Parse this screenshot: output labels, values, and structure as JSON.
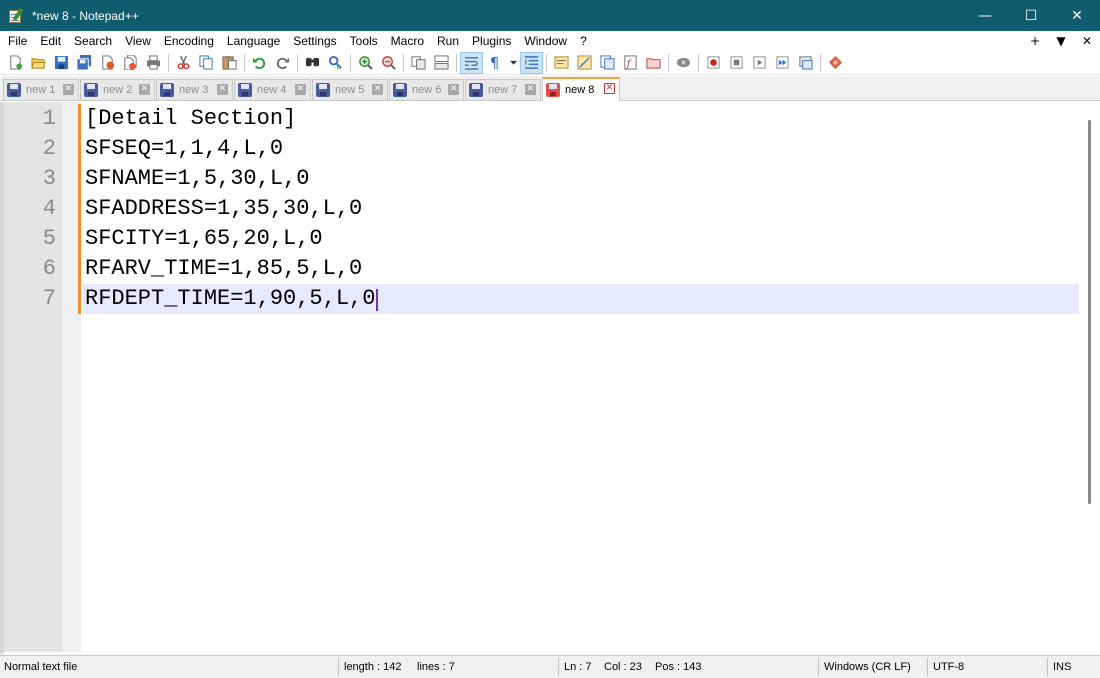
{
  "window": {
    "title": "*new 8 - Notepad++",
    "controls": {
      "minimize": "—",
      "maximize": "☐",
      "close": "✕"
    }
  },
  "menu": {
    "items": [
      "File",
      "Edit",
      "Search",
      "View",
      "Encoding",
      "Language",
      "Settings",
      "Tools",
      "Macro",
      "Run",
      "Plugins",
      "Window",
      "?"
    ],
    "right": [
      "+",
      "▼",
      "✕"
    ]
  },
  "toolbar": {
    "icons": [
      "new-file-icon",
      "open-file-icon",
      "save-icon",
      "save-all-icon",
      "close-icon",
      "close-all-icon",
      "print-icon",
      "cut-icon",
      "copy-icon",
      "paste-icon",
      "undo-icon",
      "redo-icon",
      "find-icon",
      "replace-icon",
      "zoom-in-icon",
      "zoom-out-icon",
      "sync-vertical-icon",
      "sync-horizontal-icon",
      "word-wrap-icon",
      "show-all-chars-icon",
      "indent-guide-icon",
      "user-defined-language-icon",
      "document-map-icon",
      "document-list-icon",
      "function-list-icon",
      "folder-as-workspace-icon",
      "monitoring-icon",
      "record-macro-icon",
      "stop-macro-icon",
      "play-macro-icon",
      "run-macro-multiple-icon",
      "save-macro-icon",
      "plugin-icon"
    ],
    "pilcrow": "¶"
  },
  "tabs": [
    {
      "label": "new 1",
      "active": false
    },
    {
      "label": "new 2",
      "active": false
    },
    {
      "label": "new 3",
      "active": false
    },
    {
      "label": "new 4",
      "active": false
    },
    {
      "label": "new 5",
      "active": false
    },
    {
      "label": "new 6",
      "active": false
    },
    {
      "label": "new 7",
      "active": false
    },
    {
      "label": "new 8",
      "active": true
    }
  ],
  "tab_close_glyph": "✕",
  "editor": {
    "line_numbers": [
      "1",
      "2",
      "3",
      "4",
      "5",
      "6",
      "7"
    ],
    "lines": [
      "[Detail Section]",
      "SFSEQ=1,1,4,L,0",
      "SFNAME=1,5,30,L,0",
      "SFADDRESS=1,35,30,L,0",
      "SFCITY=1,65,20,L,0",
      "RFARV_TIME=1,85,5,L,0",
      "RFDEPT_TIME=1,90,5,L,0"
    ],
    "current_line": 7
  },
  "status": {
    "file_type": "Normal text file",
    "length": "length : 142",
    "lines": "lines : 7",
    "ln": "Ln : 7",
    "col": "Col : 23",
    "pos": "Pos : 143",
    "eol": "Windows (CR LF)",
    "encoding": "UTF-8",
    "mode": "INS"
  },
  "colors": {
    "titlebar": "#0f5c6e",
    "current_line": "#e8e8ff",
    "change_marker": "#f0902a",
    "active_tab_accent": "#f8a040"
  }
}
